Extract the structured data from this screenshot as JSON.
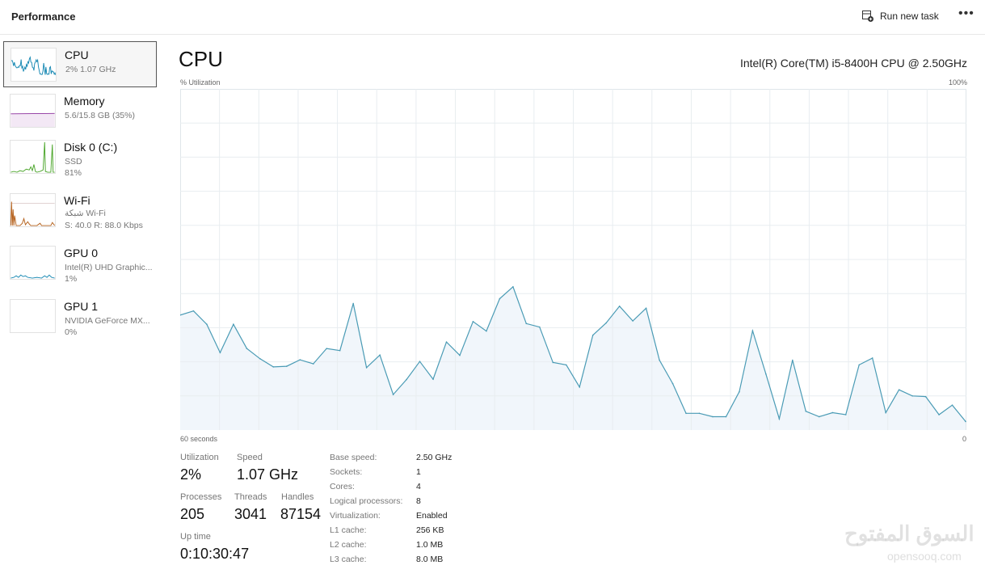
{
  "header": {
    "title": "Performance",
    "run_new_task": "Run new task",
    "more": "•••"
  },
  "sidebar": {
    "items": [
      {
        "name": "CPU",
        "sub1": "2% 1.07 GHz",
        "selected": true,
        "color": "#1a8ab4"
      },
      {
        "name": "Memory",
        "sub1": "5.6/15.8 GB (35%)",
        "color": "#8b2e9c"
      },
      {
        "name": "Disk 0 (C:)",
        "sub1": "SSD",
        "sub2": "81%",
        "color": "#4ca62b"
      },
      {
        "name": "Wi-Fi",
        "sub1": "شبكة Wi-Fi",
        "sub2": "S: 40.0 R: 88.0 Kbps",
        "color": "#b5611c"
      },
      {
        "name": "GPU 0",
        "sub1": "Intel(R) UHD Graphic...",
        "sub2": "1%",
        "color": "#1a8ab4"
      },
      {
        "name": "GPU 1",
        "sub1": "NVIDIA GeForce MX...",
        "sub2": "0%"
      }
    ]
  },
  "main": {
    "title": "CPU",
    "model": "Intel(R) Core(TM) i5-8400H CPU @ 2.50GHz"
  },
  "chart_data": {
    "type": "area",
    "ylabel": "% Utilization",
    "ymax_label": "100%",
    "xlabel_left": "60 seconds",
    "xlabel_right": "0",
    "ylim": [
      0,
      100
    ],
    "x_range_seconds": [
      60,
      0
    ],
    "grid": true,
    "line_color": "#4a9bb5",
    "fill_color": "#f1f6fb",
    "values": [
      33.7,
      34.9,
      31.0,
      22.7,
      31.0,
      23.9,
      20.9,
      18.5,
      18.7,
      20.6,
      19.4,
      23.9,
      23.3,
      37.1,
      18.3,
      22.0,
      10.4,
      14.8,
      20.1,
      14.9,
      25.8,
      21.9,
      31.8,
      29.0,
      38.5,
      42.0,
      31.2,
      30.2,
      19.8,
      19.1,
      12.6,
      27.8,
      31.4,
      36.3,
      32.0,
      35.7,
      20.5,
      13.6,
      4.9,
      4.9,
      3.9,
      3.9,
      11.2,
      29.1,
      16.4,
      3.3,
      20.5,
      5.5,
      3.9,
      5.1,
      4.5,
      19.1,
      21.1,
      5.1,
      11.8,
      10.0,
      9.8,
      4.5,
      7.3,
      2.5
    ]
  },
  "stats": {
    "utilization_label": "Utilization",
    "utilization": "2%",
    "speed_label": "Speed",
    "speed": "1.07 GHz",
    "processes_label": "Processes",
    "processes": "205",
    "threads_label": "Threads",
    "threads": "3041",
    "handles_label": "Handles",
    "handles": "87154",
    "uptime_label": "Up time",
    "uptime": "0:10:30:47"
  },
  "specs": [
    {
      "k": "Base speed:",
      "v": "2.50 GHz"
    },
    {
      "k": "Sockets:",
      "v": "1"
    },
    {
      "k": "Cores:",
      "v": "4"
    },
    {
      "k": "Logical processors:",
      "v": "8"
    },
    {
      "k": "Virtualization:",
      "v": "Enabled"
    },
    {
      "k": "L1 cache:",
      "v": "256 KB"
    },
    {
      "k": "L2 cache:",
      "v": "1.0 MB"
    },
    {
      "k": "L3 cache:",
      "v": "8.0 MB"
    }
  ],
  "watermark": {
    "arabic": "السوق المفتوح",
    "latin": "opensooq.com"
  }
}
